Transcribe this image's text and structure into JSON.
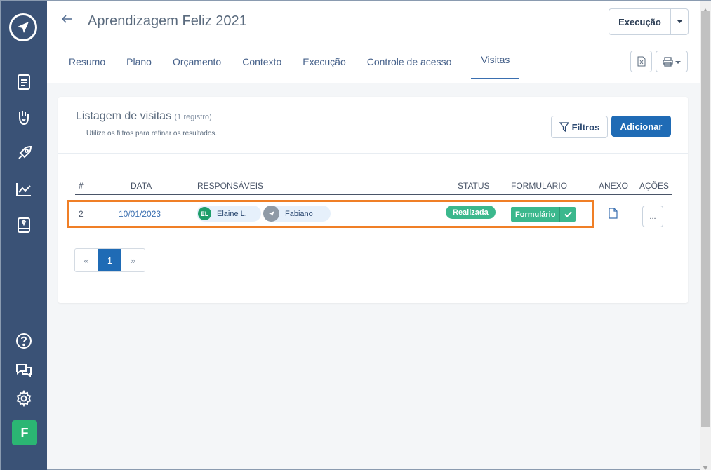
{
  "header": {
    "title": "Aprendizagem Feliz 2021",
    "exec_button": "Execução"
  },
  "tabs": [
    {
      "label": "Resumo"
    },
    {
      "label": "Plano"
    },
    {
      "label": "Orçamento"
    },
    {
      "label": "Contexto"
    },
    {
      "label": "Execução"
    },
    {
      "label": "Controle de acesso"
    },
    {
      "label": "Visitas",
      "active": true
    }
  ],
  "listing": {
    "title": "Listagem de visitas",
    "count": "(1 registro)",
    "subtitle": "Utilize os filtros para refinar os resultados.",
    "filter_button": "Filtros",
    "add_button": "Adicionar"
  },
  "table": {
    "headers": [
      "#",
      "DATA",
      "RESPONSÁVEIS",
      "STATUS",
      "FORMULÁRIO",
      "ANEXO",
      "AÇÕES"
    ],
    "rows": [
      {
        "num": "2",
        "date": "10/01/2023",
        "responsaveis": [
          {
            "initials": "EL",
            "name": "Elaine L."
          },
          {
            "initials": "",
            "name": "Fabiano"
          }
        ],
        "status": "Realizada",
        "form": "Formulário",
        "actions": "..."
      }
    ]
  },
  "pagination": {
    "prev": "«",
    "current": "1",
    "next": "»"
  },
  "user": {
    "initial": "F"
  },
  "colors": {
    "sidebar": "#3a5276",
    "primary": "#1f6bb5",
    "success": "#3bb88d",
    "highlight": "#f07f26"
  }
}
